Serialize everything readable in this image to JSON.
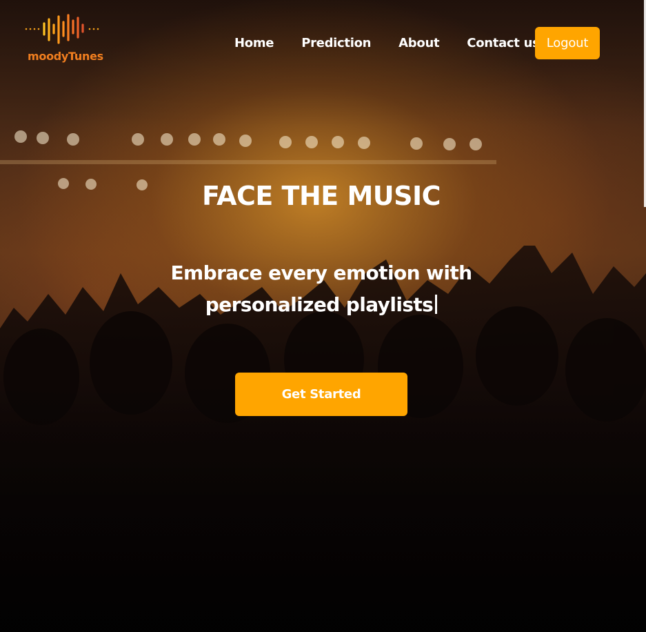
{
  "brand": {
    "name": "moodyTunes",
    "logo_icon": "sound-wave-icon",
    "accent_color": "#ffa500",
    "logo_color": "#f07e1f"
  },
  "nav": {
    "items": [
      {
        "label": "Home"
      },
      {
        "label": "Prediction"
      },
      {
        "label": "About"
      },
      {
        "label": "Contact us"
      }
    ],
    "logout_label": "Logout"
  },
  "hero": {
    "title": "FACE THE MUSIC",
    "subtitle": "Embrace every emotion with personalized playlists",
    "cta_label": "Get Started"
  }
}
